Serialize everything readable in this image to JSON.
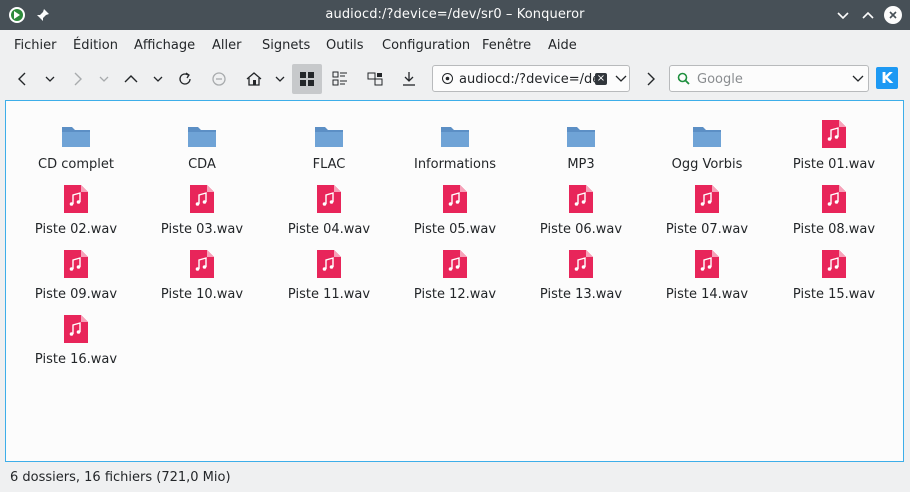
{
  "window": {
    "title": "audiocd:/?device=/dev/sr0 – Konqueror"
  },
  "menubar": {
    "items": [
      {
        "label": "Fichier"
      },
      {
        "label": "Édition"
      },
      {
        "label": "Affichage"
      },
      {
        "label": "Aller"
      },
      {
        "label": "Signets"
      },
      {
        "label": "Outils"
      },
      {
        "label": "Configuration"
      },
      {
        "label": "Fenêtre"
      },
      {
        "label": "Aide"
      }
    ]
  },
  "location": {
    "url": "audiocd:/?device=/dev/sr0"
  },
  "search": {
    "placeholder": "Google"
  },
  "files": [
    {
      "name": "CD complet",
      "type": "folder"
    },
    {
      "name": "CDA",
      "type": "folder"
    },
    {
      "name": "FLAC",
      "type": "folder"
    },
    {
      "name": "Informations",
      "type": "folder"
    },
    {
      "name": "MP3",
      "type": "folder"
    },
    {
      "name": "Ogg Vorbis",
      "type": "folder"
    },
    {
      "name": "Piste 01.wav",
      "type": "audio"
    },
    {
      "name": "Piste 02.wav",
      "type": "audio"
    },
    {
      "name": "Piste 03.wav",
      "type": "audio"
    },
    {
      "name": "Piste 04.wav",
      "type": "audio"
    },
    {
      "name": "Piste 05.wav",
      "type": "audio"
    },
    {
      "name": "Piste 06.wav",
      "type": "audio"
    },
    {
      "name": "Piste 07.wav",
      "type": "audio"
    },
    {
      "name": "Piste 08.wav",
      "type": "audio"
    },
    {
      "name": "Piste 09.wav",
      "type": "audio"
    },
    {
      "name": "Piste 10.wav",
      "type": "audio"
    },
    {
      "name": "Piste 11.wav",
      "type": "audio"
    },
    {
      "name": "Piste 12.wav",
      "type": "audio"
    },
    {
      "name": "Piste 13.wav",
      "type": "audio"
    },
    {
      "name": "Piste 14.wav",
      "type": "audio"
    },
    {
      "name": "Piste 15.wav",
      "type": "audio"
    },
    {
      "name": "Piste 16.wav",
      "type": "audio"
    }
  ],
  "status": {
    "text": "6 dossiers, 16 fichiers (721,0 Mio)"
  },
  "colors": {
    "accent": "#3daee9",
    "folder": "#5c8fc5",
    "audio": "#e8255a"
  }
}
